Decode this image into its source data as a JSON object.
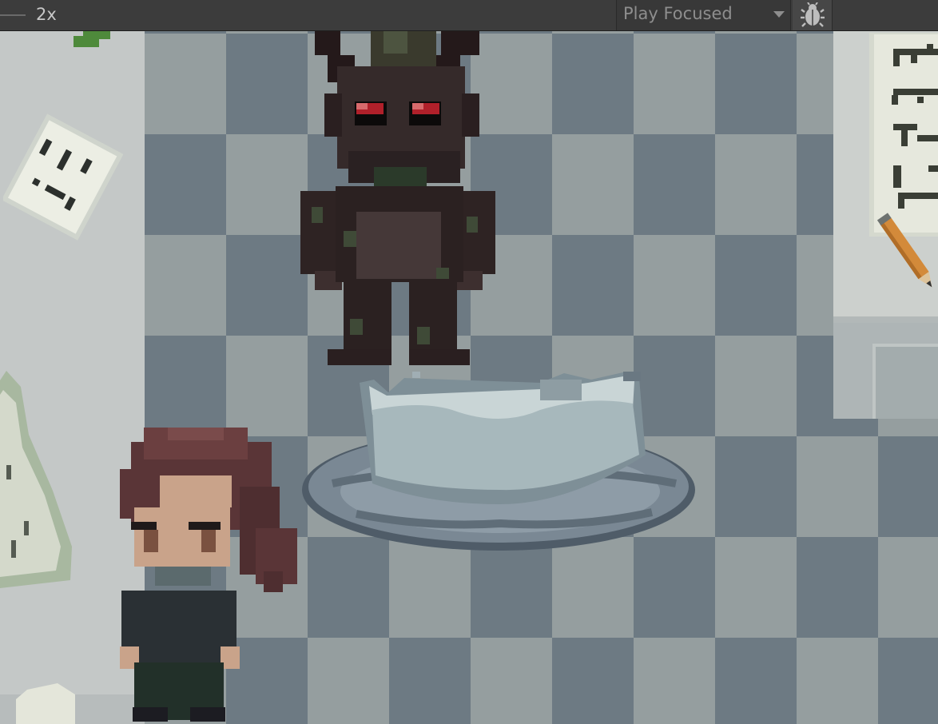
{
  "toolbar": {
    "zoom_label": "2x",
    "play_mode": "Play Focused",
    "debug_icon": "bug-icon"
  },
  "scene": {
    "type": "top-down pixel-art game view",
    "sprites": [
      "dark-horned-creature",
      "stone-fountain",
      "girl-character",
      "parchment-note",
      "wall-notes",
      "pencil",
      "paper-pile"
    ]
  }
}
